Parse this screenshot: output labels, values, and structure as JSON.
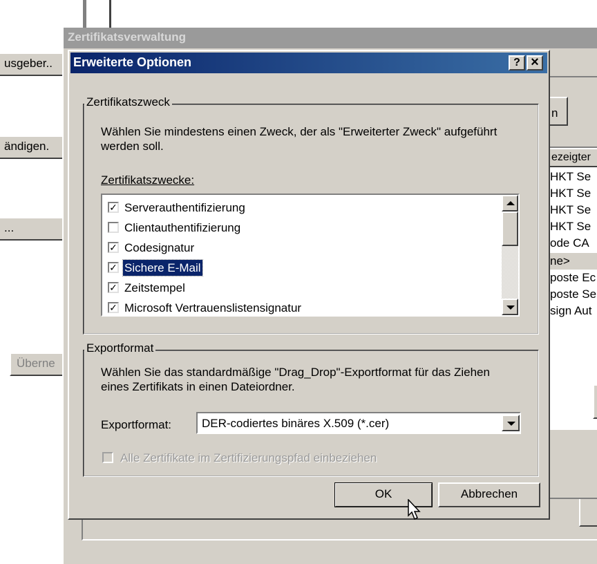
{
  "background_window": {
    "left_buttons": [
      "usgeber..",
      "ändigen.",
      "...",
      "Überne"
    ],
    "tab_fragment": "n",
    "list_header": "ezeigter",
    "list_items": [
      "HKT Se",
      "HKT Se",
      "HKT Se",
      "HKT Se",
      "ode CA",
      "ne>",
      "poste Ec",
      "poste Se",
      "sign Aut"
    ]
  },
  "outer_window": {
    "title": "Zertifikatsverwaltung"
  },
  "dialog": {
    "title": "Erweiterte Optionen",
    "help_button": "?",
    "close_button": "×",
    "group_purpose": {
      "label": "Zertifikatszweck",
      "description": "Wählen Sie mindestens einen Zweck, der als \"Erweiterter Zweck\" aufgeführt werden soll.",
      "list_label": "Zertifikatszwecke:",
      "items": [
        {
          "label": "Serverauthentifizierung",
          "checked": true
        },
        {
          "label": "Clientauthentifizierung",
          "checked": false
        },
        {
          "label": "Codesignatur",
          "checked": true
        },
        {
          "label": "Sichere E-Mail",
          "checked": true,
          "selected": true
        },
        {
          "label": "Zeitstempel",
          "checked": true
        },
        {
          "label": "Microsoft Vertrauenslistensignatur",
          "checked": true
        }
      ]
    },
    "group_export": {
      "label": "Exportformat",
      "description": "Wählen Sie das standardmäßige \"Drag_Drop\"-Exportformat für das Ziehen eines Zertifikats in einen Dateiordner.",
      "format_label": "Exportformat:",
      "format_value": "DER-codiertes binäres X.509 (*.cer)",
      "include_chain_label": "Alle Zertifikate im Zertifizierungspfad einbeziehen",
      "include_chain_checked": false
    },
    "ok_button": "OK",
    "cancel_button": "Abbrechen"
  },
  "colors": {
    "titlebar_active": "#0a246a",
    "titlebar_inactive": "#808080",
    "face": "#d4d0c8",
    "selection": "#0a246a"
  }
}
